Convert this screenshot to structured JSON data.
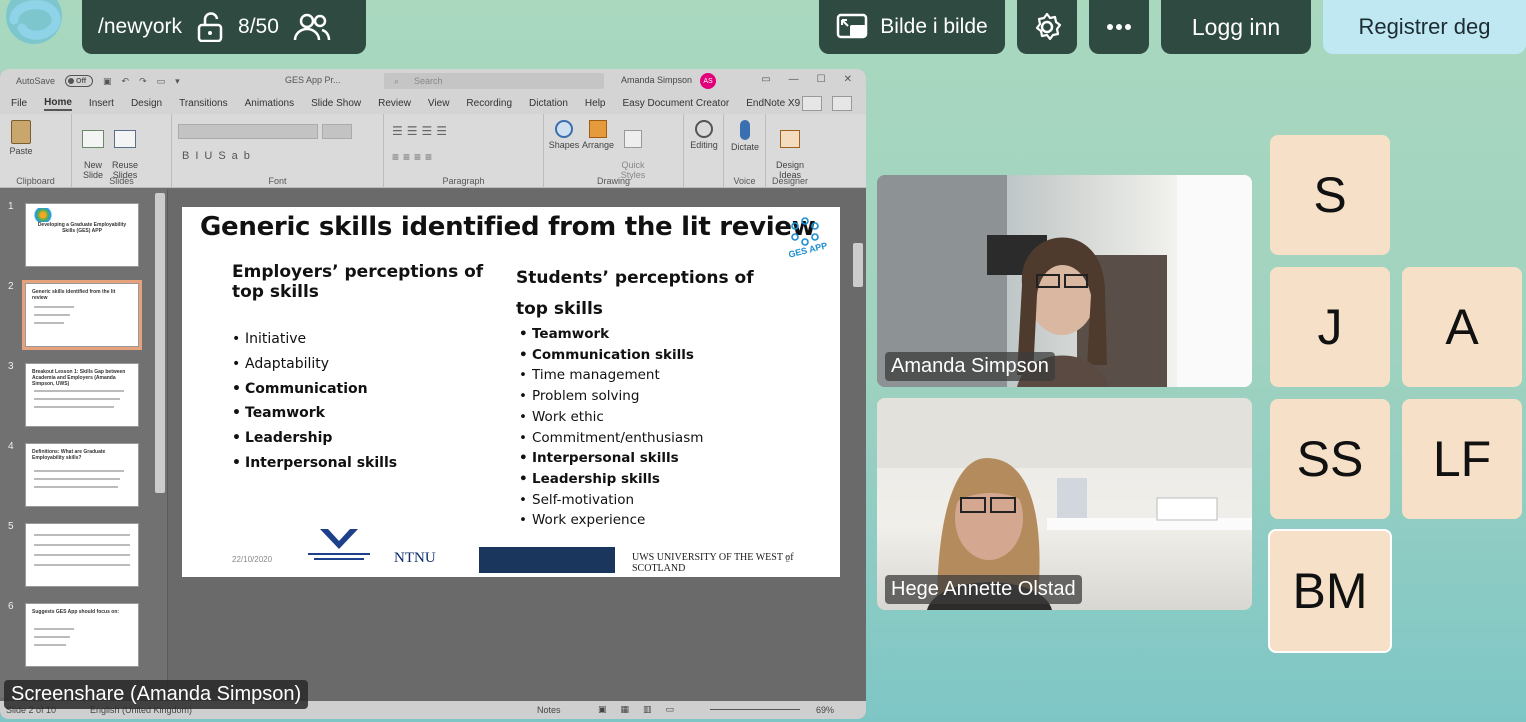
{
  "topbar": {
    "room_name": "/newyork",
    "participant_count": "8/50",
    "pip_label": "Bilde i bilde",
    "login_label": "Logg inn",
    "register_label": "Registrer deg"
  },
  "powerpoint": {
    "autosave": "AutoSave",
    "autosave_state": "Off",
    "file_name": "GES App Pr...",
    "search_placeholder": "Search",
    "user_name": "Amanda Simpson",
    "user_initials": "AS",
    "menu": [
      "File",
      "Home",
      "Insert",
      "Design",
      "Transitions",
      "Animations",
      "Slide Show",
      "Review",
      "View",
      "Recording",
      "Dictation",
      "Help",
      "Easy Document Creator",
      "EndNote X9"
    ],
    "active_menu": "Home",
    "ribbon": {
      "paste": "Paste",
      "new_slide": "New\nSlide",
      "reuse_slides": "Reuse\nSlides",
      "shapes": "Shapes",
      "arrange": "Arrange",
      "quick_styles": "Quick\nStyles",
      "editing": "Editing",
      "dictate": "Dictate",
      "design_ideas": "Design\nIdeas",
      "groups": [
        "Clipboard",
        "Slides",
        "Font",
        "Paragraph",
        "Drawing",
        "Voice",
        "Designer"
      ]
    },
    "thumb_numbers": [
      "1",
      "2",
      "3",
      "4",
      "5",
      "6"
    ],
    "thumb_titles": [
      "Developing a Graduate Employability Skills (GES) APP",
      "Generic skills identified from the lit review",
      "Breakout Lesson 1: Skills Gap between Academia and Employers (Amanda Simpson, UWS)",
      "Definitions: What are Graduate Employability skills?",
      "",
      "Suggests GES App should focus on:"
    ],
    "status": {
      "slide_of": "Slide 2 of 10",
      "language": "English (United Kingdom)",
      "notes": "Notes",
      "zoom": "69%"
    }
  },
  "slide": {
    "title": "Generic skills identified from the lit review",
    "left_heading": "Employers’ perceptions of top skills",
    "right_heading": "Students’ perceptions of top skills",
    "left_items": [
      {
        "text": "Initiative",
        "bold": false
      },
      {
        "text": "Adaptability",
        "bold": false
      },
      {
        "text": "Communication",
        "bold": true
      },
      {
        "text": "Teamwork",
        "bold": true
      },
      {
        "text": "Leadership",
        "bold": true
      },
      {
        "text": "Interpersonal skills",
        "bold": true
      }
    ],
    "right_items": [
      {
        "text": "Teamwork",
        "bold": true
      },
      {
        "text": "Communication skills",
        "bold": true
      },
      {
        "text": "Time management",
        "bold": false
      },
      {
        "text": "Problem solving",
        "bold": false
      },
      {
        "text": "Work ethic",
        "bold": false
      },
      {
        "text": "Commitment/enthusiasm",
        "bold": false
      },
      {
        "text": "Interpersonal skills",
        "bold": true
      },
      {
        "text": "Leadership skills",
        "bold": true
      },
      {
        "text": "Self-motivation",
        "bold": false
      },
      {
        "text": "Work experience",
        "bold": false
      }
    ],
    "date": "22/10/2020",
    "page_number": "2",
    "ges_logo_text": "GES APP",
    "partner_logos": [
      "NTNU",
      "UWS UNIVERSITY OF THE WEST of SCOTLAND"
    ]
  },
  "share_label": "Screenshare (Amanda Simpson)",
  "videos": [
    {
      "name": "Amanda Simpson"
    },
    {
      "name": "Hege Annette Olstad"
    }
  ],
  "avatars": [
    "S",
    "J",
    "A",
    "SS",
    "LF",
    "BM"
  ],
  "colors": {
    "topbar_bg": "#2f4a40",
    "register_bg": "#bfe8f2",
    "avatar_bg": "#f6e1c8",
    "page_bg_top": "#a9d8bf",
    "page_bg_bottom": "#7ec6c6"
  }
}
